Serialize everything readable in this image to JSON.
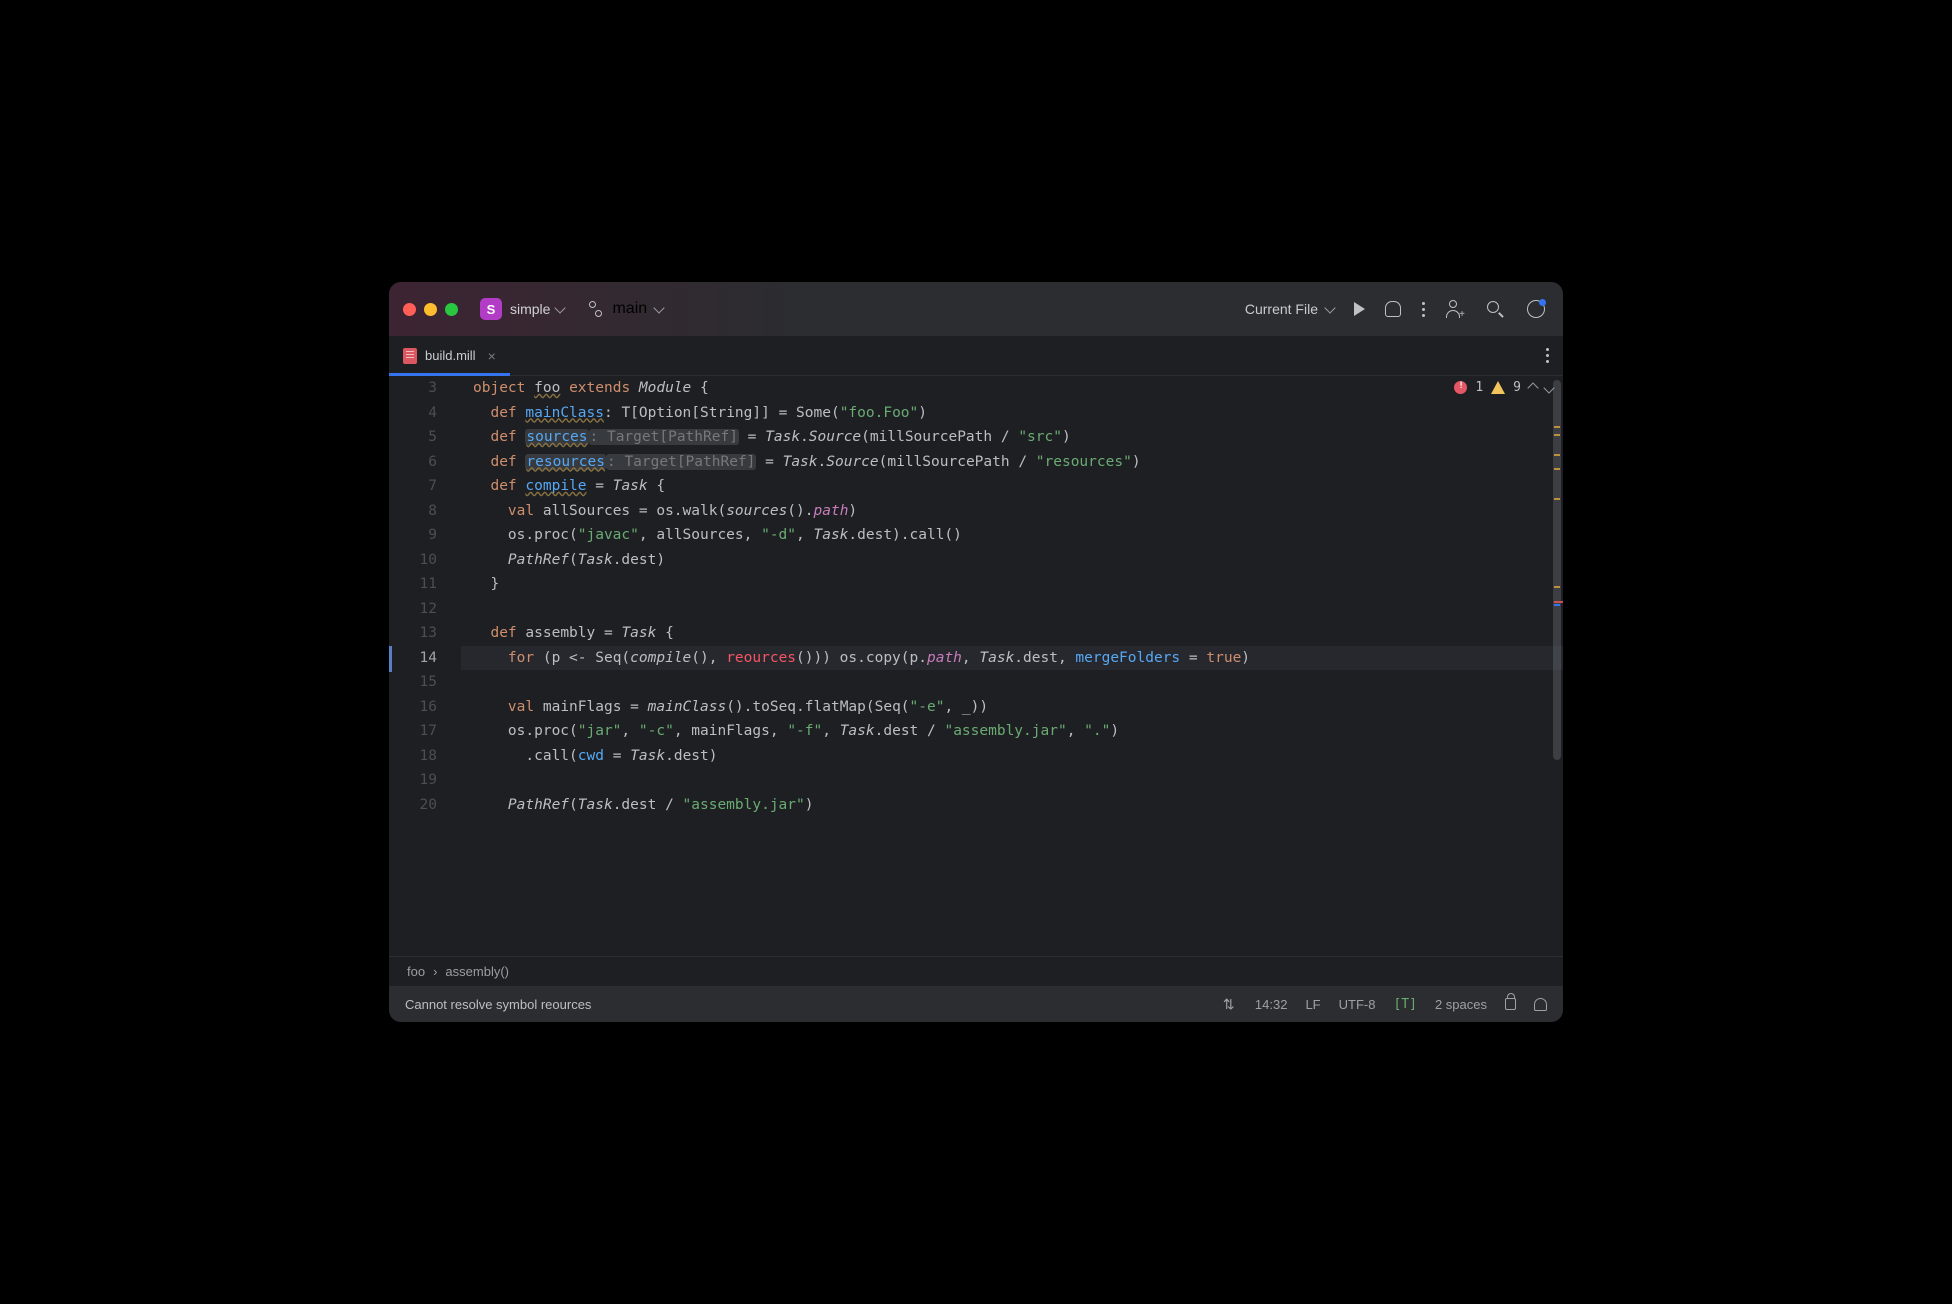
{
  "titlebar": {
    "project_badge": "S",
    "project_name": "simple",
    "branch": "main",
    "run_config": "Current File"
  },
  "tabs": [
    {
      "filename": "build.mill",
      "active": true
    }
  ],
  "inspections": {
    "error_count": "1",
    "warning_count": "9"
  },
  "gutter": {
    "start": 3,
    "end": 20,
    "lines": [
      "3",
      "4",
      "5",
      "6",
      "7",
      "8",
      "9",
      "10",
      "11",
      "12",
      "13",
      "14",
      "15",
      "16",
      "17",
      "18",
      "19",
      "20"
    ],
    "error_on_line": 13,
    "current_line": 14
  },
  "code": {
    "l3": {
      "kw0": "object",
      "id": "foo",
      "kw1": "extends",
      "mod": "Module",
      "br": " {"
    },
    "l4": {
      "kw": "def",
      "name": "mainClass",
      "sig": ": T[Option[String]] = Some(",
      "str": "\"foo.Foo\"",
      "tail": ")"
    },
    "l5": {
      "kw": "def",
      "name": "sources",
      "gt": ": Target[PathRef]",
      "eq": " = ",
      "task": "Task",
      "dot": ".",
      "src": "Source",
      "open": "(millSourcePath / ",
      "str": "\"src\"",
      "close": ")"
    },
    "l6": {
      "kw": "def",
      "name": "resources",
      "gt": ": Target[PathRef]",
      "eq": " = ",
      "task": "Task",
      "dot": ".",
      "src": "Source",
      "open": "(millSourcePath / ",
      "str": "\"resources\"",
      "close": ")"
    },
    "l7": {
      "kw": "def",
      "name": "compile",
      "eq": " = ",
      "task": "Task",
      "br": " {"
    },
    "l8": {
      "kw": "val",
      "name": " allSources = os.walk(",
      "fn": "sources",
      "mid": "().",
      "path": "path",
      "close": ")"
    },
    "l9": {
      "head": "os.proc(",
      "s1": "\"javac\"",
      "mid1": ", allSources, ",
      "s2": "\"-d\"",
      "mid2": ", ",
      "task": "Task",
      "tail": ".dest).call()"
    },
    "l10": {
      "pr": "PathRef",
      "open": "(",
      "task": "Task",
      "tail": ".dest)"
    },
    "l11": {
      "txt": "}"
    },
    "l12": {
      "txt": ""
    },
    "l13": {
      "kw": "def",
      "name": " assembly = ",
      "task": "Task",
      "br": " {"
    },
    "l14": {
      "kw": "for",
      "open": " (p <- Seq(",
      "fn1": "compile",
      "mid1": "(), ",
      "err": "reources",
      "mid2": "())) os.copy(p.",
      "path": "path",
      "mid3": ", ",
      "task": "Task",
      "mid4": ".dest, ",
      "arg": "mergeFolders",
      "eq": " = ",
      "true": "true",
      "close": ")"
    },
    "l15": {
      "txt": ""
    },
    "l16": {
      "kw": "val",
      "txt": " mainFlags = ",
      "fn": "mainClass",
      "mid": "().toSeq.flatMap(Seq(",
      "s": "\"-e\"",
      "tail": ", _))"
    },
    "l17": {
      "head": "os.proc(",
      "s1": "\"jar\"",
      "c1": ", ",
      "s2": "\"-c\"",
      "c2": ", mainFlags, ",
      "s3": "\"-f\"",
      "c3": ", ",
      "task": "Task",
      "mid": ".dest / ",
      "s4": "\"assembly.jar\"",
      "c4": ", ",
      "s5": "\".\"",
      "close": ")"
    },
    "l18": {
      "head": ".call(",
      "arg": "cwd",
      "eq": " = ",
      "task": "Task",
      "tail": ".dest)"
    },
    "l19": {
      "txt": ""
    },
    "l20": {
      "pr": "PathRef",
      "open": "(",
      "task": "Task",
      "mid": ".dest / ",
      "s": "\"assembly.jar\"",
      "close": ")"
    }
  },
  "breadcrumb": {
    "a": "foo",
    "sep": "›",
    "b": "assembly()"
  },
  "status": {
    "message": "Cannot resolve symbol reources",
    "time": "14:32",
    "line_sep": "LF",
    "encoding": "UTF-8",
    "indent": "2 spaces",
    "t_indicator": "[T]"
  }
}
